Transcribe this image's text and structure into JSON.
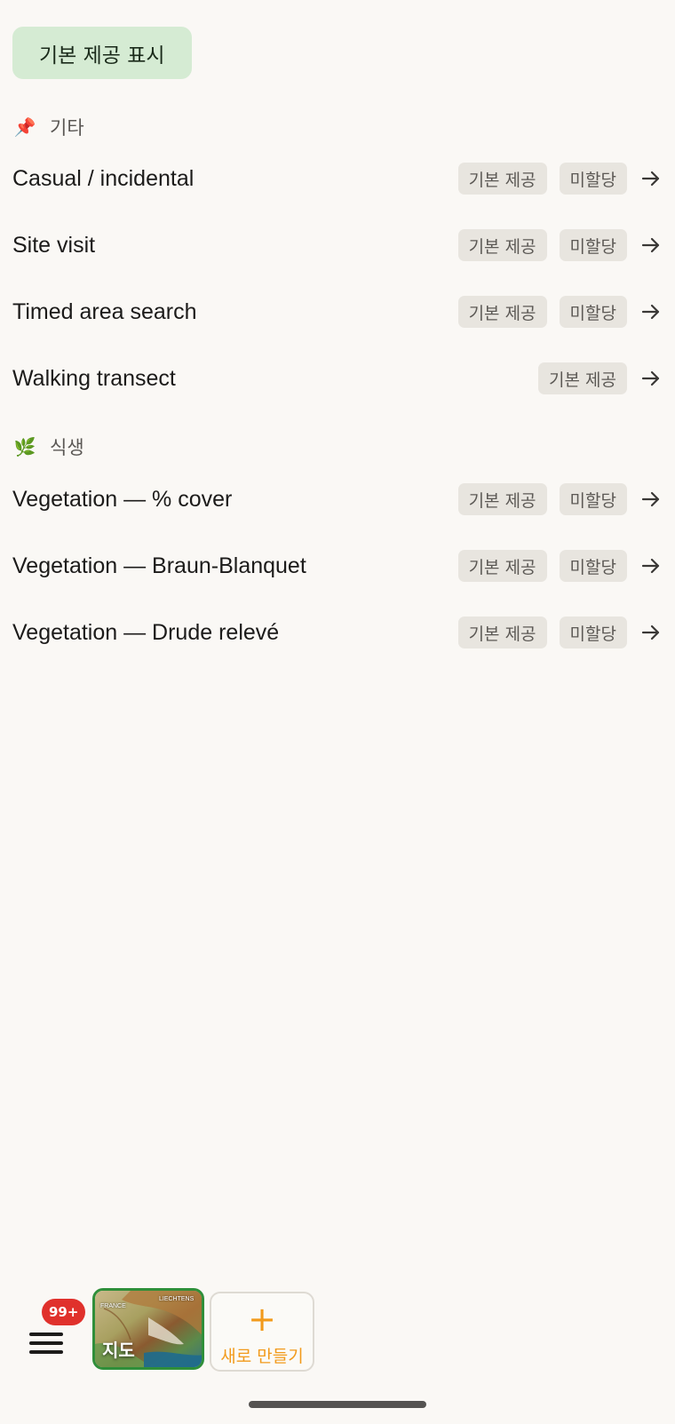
{
  "filter": {
    "label": "기본 제공 표시"
  },
  "sections": [
    {
      "icon": "pushpin-icon",
      "emoji": "📌",
      "title": "기타",
      "items": [
        {
          "title": "Casual / incidental",
          "badges": [
            "기본 제공",
            "미할당"
          ]
        },
        {
          "title": "Site visit",
          "badges": [
            "기본 제공",
            "미할당"
          ]
        },
        {
          "title": "Timed area search",
          "badges": [
            "기본 제공",
            "미할당"
          ]
        },
        {
          "title": "Walking transect",
          "badges": [
            "기본 제공"
          ]
        }
      ]
    },
    {
      "icon": "herb-icon",
      "emoji": "🌿",
      "title": "식생",
      "items": [
        {
          "title": "Vegetation — % cover",
          "badges": [
            "기본 제공",
            "미할당"
          ]
        },
        {
          "title": "Vegetation — Braun-Blanquet",
          "badges": [
            "기본 제공",
            "미할당"
          ]
        },
        {
          "title": "Vegetation — Drude relevé",
          "badges": [
            "기본 제공",
            "미할당"
          ]
        }
      ]
    }
  ],
  "bottom_bar": {
    "notification_count": "99+",
    "map_label": "지도",
    "map_place_labels": [
      "FRANCE",
      "LIECHTENS"
    ],
    "create_label": "새로 만들기",
    "create_symbol": "+"
  },
  "colors": {
    "background": "#faf8f5",
    "filter_chip": "#d5ebd3",
    "badge_bg": "#e8e5df",
    "badge_text": "#5c5955",
    "notification": "#e0312c",
    "map_border": "#2f8f3a",
    "accent_orange": "#f29a1b"
  }
}
